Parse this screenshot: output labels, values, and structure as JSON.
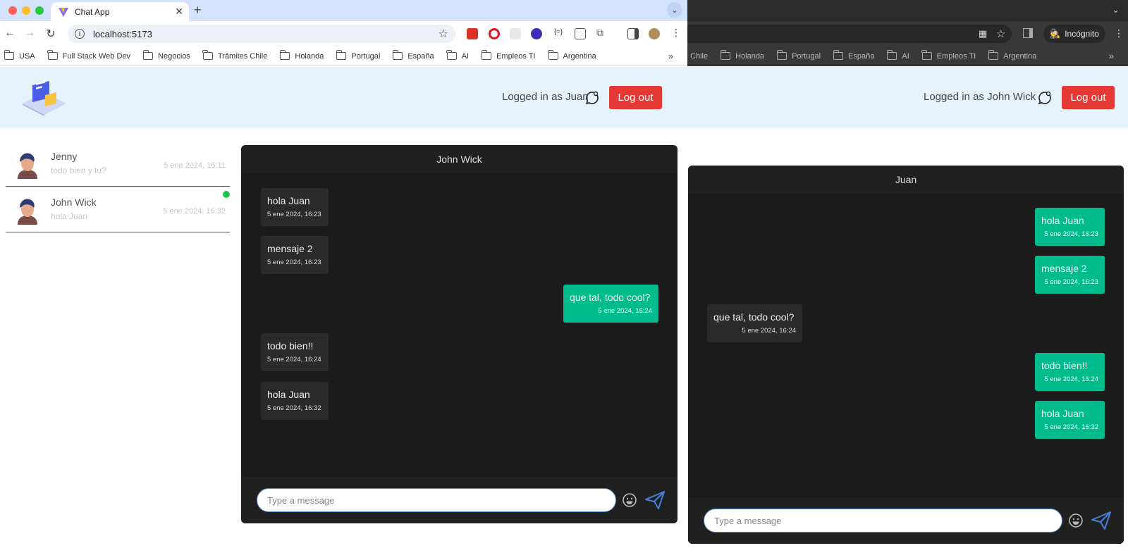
{
  "left_window": {
    "tab_title": "Chat App",
    "url": "localhost:5173",
    "bookmarks": [
      "USA",
      "Full Stack Web Dev",
      "Negocios",
      "Trámites Chile",
      "Holanda",
      "Portugal",
      "España",
      "AI",
      "Empleos TI",
      "Argentina"
    ],
    "header": {
      "logged_in": "Logged in as Juan",
      "logout": "Log out"
    },
    "contacts": [
      {
        "name": "Jenny",
        "last_message": "todo bien y tu?",
        "time": "5 ene 2024, 16:11",
        "online": false
      },
      {
        "name": "John Wick",
        "last_message": "hola Juan",
        "time": "5 ene 2024, 16:32",
        "online": true
      }
    ],
    "chat": {
      "title": "John Wick",
      "messages": [
        {
          "text": "hola Juan",
          "time": "5 ene 2024, 16:23",
          "direction": "received"
        },
        {
          "text": "mensaje 2",
          "time": "5 ene 2024, 16:23",
          "direction": "received"
        },
        {
          "text": "que tal, todo cool?",
          "time": "5 ene 2024, 16:24",
          "direction": "sent"
        },
        {
          "text": "todo bien!!",
          "time": "5 ene 2024, 16:24",
          "direction": "received"
        },
        {
          "text": "hola Juan",
          "time": "5 ene 2024, 16:32",
          "direction": "received"
        }
      ],
      "input_placeholder": "Type a message"
    }
  },
  "right_window": {
    "incognito_label": "Incógnito",
    "bookmarks": [
      "Chile",
      "Holanda",
      "Portugal",
      "España",
      "AI",
      "Empleos TI",
      "Argentina"
    ],
    "header": {
      "logged_in": "Logged in as John Wick",
      "logout": "Log out"
    },
    "chat": {
      "title": "Juan",
      "messages": [
        {
          "text": "hola Juan",
          "time": "5 ene 2024, 16:23",
          "direction": "sent"
        },
        {
          "text": "mensaje 2",
          "time": "5 ene 2024, 16:23",
          "direction": "sent"
        },
        {
          "text": "que tal, todo cool?",
          "time": "5 ene 2024, 16:24",
          "direction": "received"
        },
        {
          "text": "todo bien!!",
          "time": "5 ene 2024, 16:24",
          "direction": "sent"
        },
        {
          "text": "hola Juan",
          "time": "5 ene 2024, 16:32",
          "direction": "sent"
        }
      ],
      "input_placeholder": "Type a message"
    }
  },
  "colors": {
    "accent_sent": "#00bc8c",
    "logout_red": "#e53935",
    "header_bg": "#e5f4fc",
    "chat_bg": "#1b1b1b",
    "online": "#22c44a"
  }
}
